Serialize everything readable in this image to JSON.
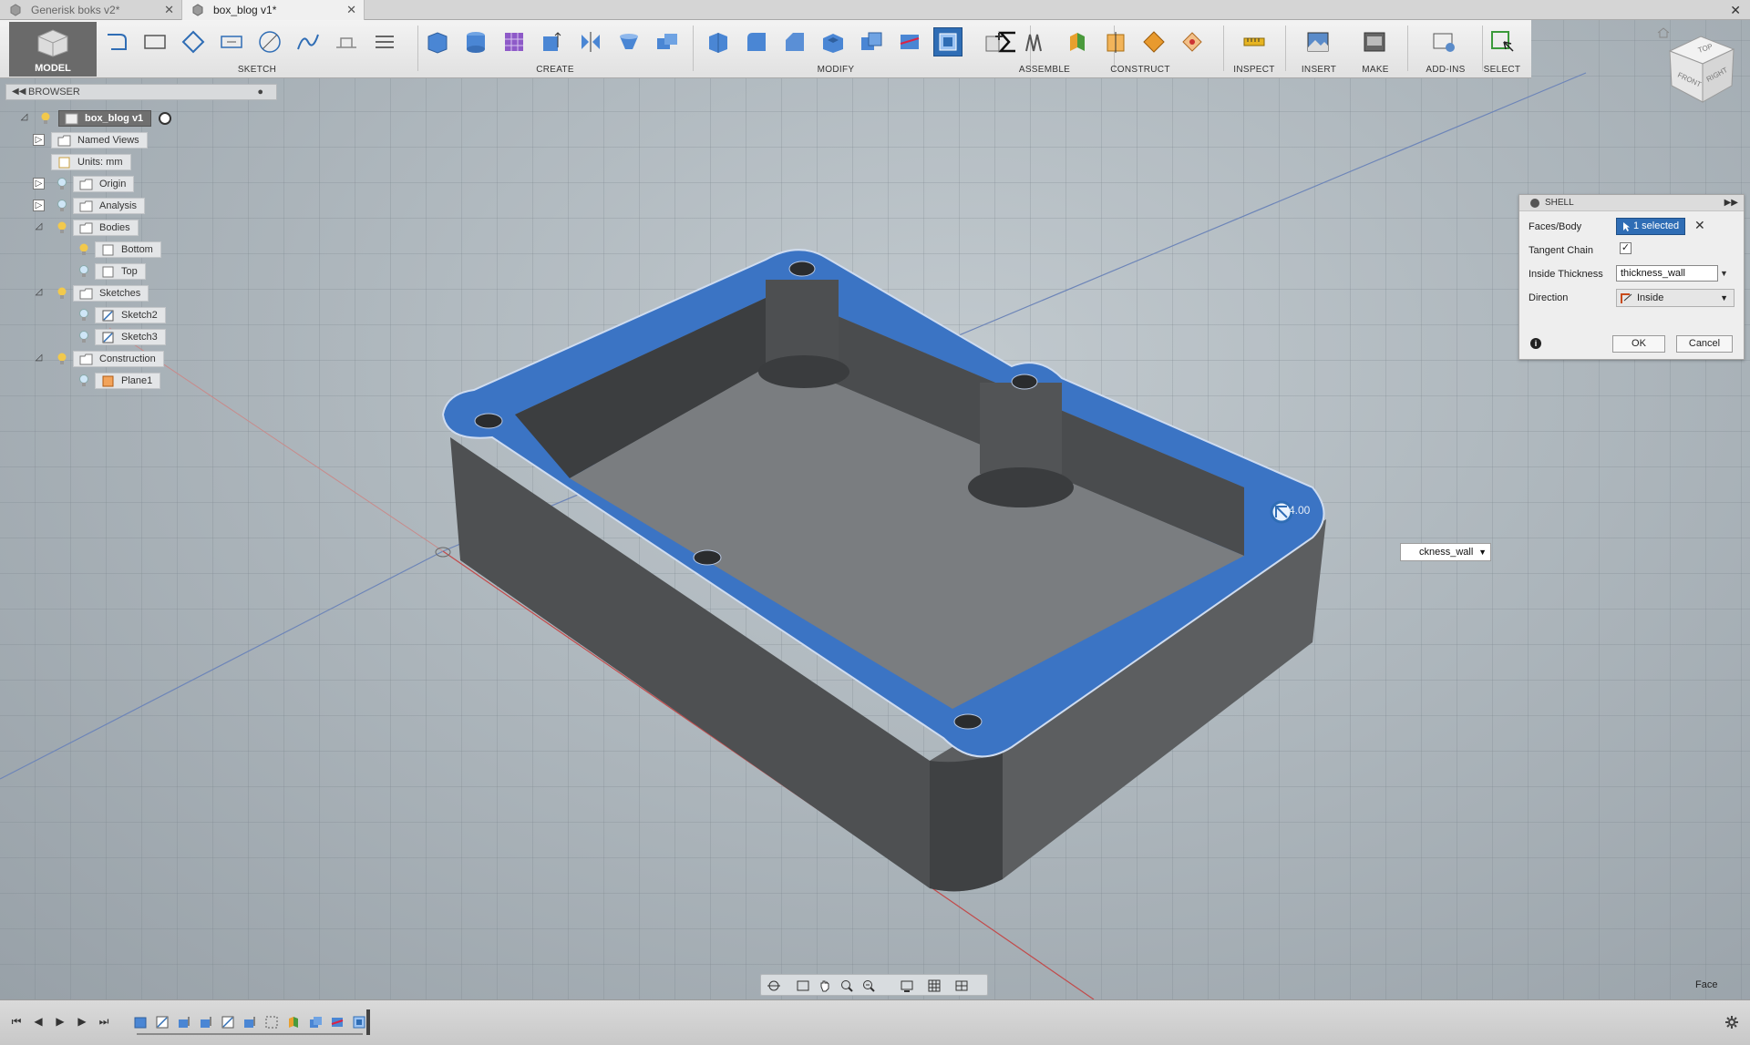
{
  "tabs": [
    {
      "label": "Generisk boks v2*",
      "active": false
    },
    {
      "label": "box_blog v1*",
      "active": true
    }
  ],
  "toolbar": {
    "model_label": "MODEL",
    "groups": {
      "sketch": "SKETCH",
      "create": "CREATE",
      "modify": "MODIFY",
      "assemble": "ASSEMBLE",
      "construct": "CONSTRUCT",
      "inspect": "INSPECT",
      "insert": "INSERT",
      "make": "MAKE",
      "addins": "ADD-INS",
      "select": "SELECT"
    }
  },
  "browser": {
    "title": "BROWSER",
    "items": [
      {
        "label": "box_blog v1"
      },
      {
        "label": "Named Views"
      },
      {
        "label": "Units: mm"
      },
      {
        "label": "Origin"
      },
      {
        "label": "Analysis"
      },
      {
        "label": "Bodies"
      },
      {
        "label": "Bottom"
      },
      {
        "label": "Top"
      },
      {
        "label": "Sketches"
      },
      {
        "label": "Sketch2"
      },
      {
        "label": "Sketch3"
      },
      {
        "label": "Construction"
      },
      {
        "label": "Plane1"
      }
    ]
  },
  "shell_dialog": {
    "title": "SHELL",
    "faces_label": "Faces/Body",
    "faces_value": "1 selected",
    "tangent_label": "Tangent Chain",
    "tangent_checked": true,
    "thickness_label": "Inside Thickness",
    "thickness_value": "thickness_wall",
    "direction_label": "Direction",
    "direction_value": "Inside",
    "ok_label": "OK",
    "cancel_label": "Cancel"
  },
  "viewport": {
    "floating_input": "ckness_wall",
    "dimension_label": "4.00",
    "status_label": "Face"
  },
  "viewcube": {
    "top": "TOP",
    "front": "FRONT",
    "right": "RIGHT"
  },
  "colors": {
    "selection_blue": "#3b74c4",
    "body_gray": "#5a5c5e",
    "highlight": "#2f6db5"
  }
}
